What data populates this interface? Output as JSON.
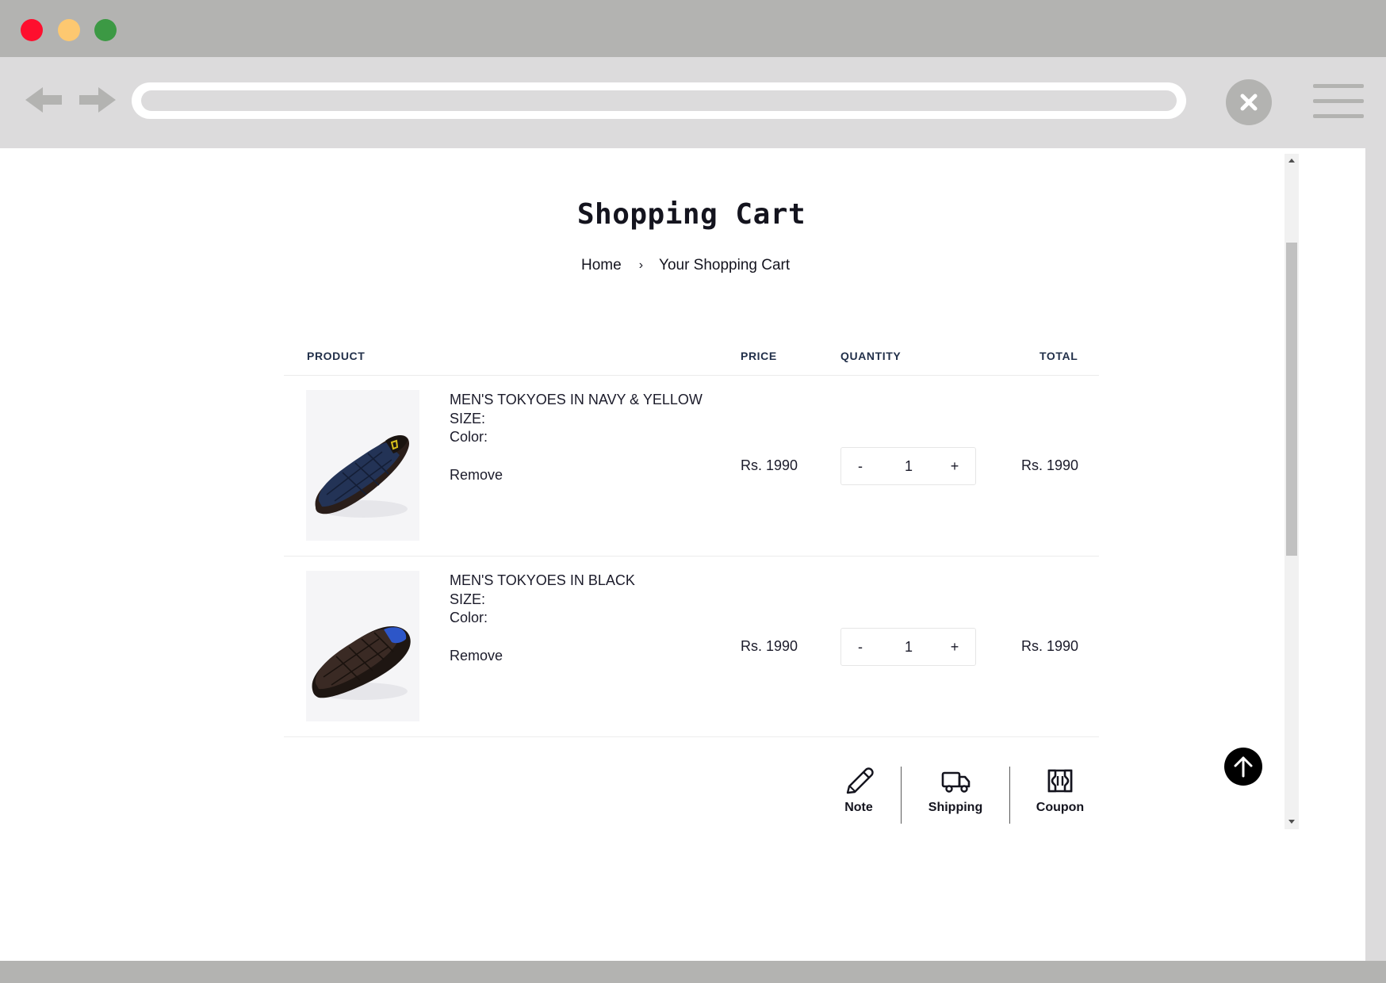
{
  "window": {
    "controls": [
      "close",
      "minimize",
      "maximize"
    ],
    "icons": {
      "back": "arrow-left-icon",
      "forward": "arrow-right-icon",
      "close": "close-icon",
      "menu": "hamburger-menu-icon"
    }
  },
  "page": {
    "title": "Shopping Cart",
    "breadcrumb": {
      "home": "Home",
      "separator": "›",
      "current": "Your Shopping Cart"
    }
  },
  "table": {
    "headers": {
      "product": "PRODUCT",
      "price": "PRICE",
      "quantity": "QUANTITY",
      "total": "TOTAL"
    }
  },
  "items": [
    {
      "name": "MEN'S TOKYOES IN NAVY & YELLOW",
      "size_label": "SIZE:",
      "color_label": "Color:",
      "remove_label": "Remove",
      "price": "Rs. 1990",
      "qty_minus": "-",
      "quantity": "1",
      "qty_plus": "+",
      "total": "Rs. 1990",
      "image_icon": "slipper-navy-image"
    },
    {
      "name": "MEN'S TOKYOES IN BLACK",
      "size_label": "SIZE:",
      "color_label": "Color:",
      "remove_label": "Remove",
      "price": "Rs. 1990",
      "qty_minus": "-",
      "quantity": "1",
      "qty_plus": "+",
      "total": "Rs. 1990",
      "image_icon": "slipper-black-image"
    }
  ],
  "actions": [
    {
      "label": "Note",
      "icon": "pencil-icon"
    },
    {
      "label": "Shipping",
      "icon": "truck-icon"
    },
    {
      "label": "Coupon",
      "icon": "coupon-icon"
    }
  ],
  "colors": {
    "titlebar": "#b3b3b1",
    "toolbar": "#dcdbdc",
    "close_dot": "#fe0f2e",
    "minimize_dot": "#fdc870",
    "maximize_dot": "#3c9944",
    "text": "#14141e",
    "header_text": "#22304a"
  }
}
